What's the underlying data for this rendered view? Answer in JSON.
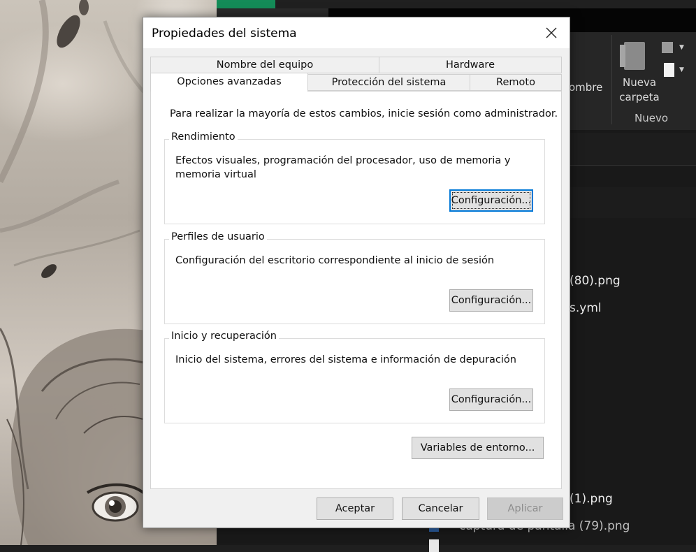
{
  "dialog": {
    "title": "Propiedades del sistema",
    "tabs_back": [
      "Nombre del equipo",
      "Hardware"
    ],
    "tabs_front": [
      "Opciones avanzadas",
      "Protección del sistema",
      "Remoto"
    ],
    "active_tab": "Opciones avanzadas",
    "admin_note": "Para realizar la mayoría de estos cambios, inicie sesión como administrador.",
    "groups": [
      {
        "title": "Rendimiento",
        "description": "Efectos visuales, programación del procesador, uso de memoria y memoria virtual",
        "button": "Configuración..."
      },
      {
        "title": "Perfiles de usuario",
        "description": "Configuración del escritorio correspondiente al inicio de sesión",
        "button": "Configuración..."
      },
      {
        "title": "Inicio y recuperación",
        "description": "Inicio del sistema, errores del sistema e información de depuración",
        "button": "Configuración..."
      }
    ],
    "env_button": "Variables de entorno...",
    "footer": {
      "accept": "Aceptar",
      "cancel": "Cancelar",
      "apply": "Aplicar"
    }
  },
  "explorer": {
    "ribbon": {
      "rename_partial": "ombre",
      "new_folder_line1": "Nueva",
      "new_folder_line2": "carpeta",
      "group_new": "Nuevo"
    },
    "files": [
      "(80).png",
      "s.yml",
      "(1).png",
      "captura de pantalla (79).png"
    ]
  },
  "colors": {
    "focus_border": "#0078d7",
    "explorer_bg": "#191919",
    "accent_green": "#148c58"
  }
}
